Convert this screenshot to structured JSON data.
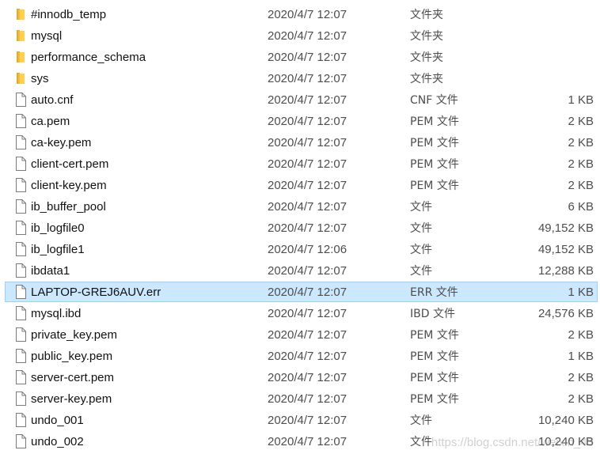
{
  "colors": {
    "folder_fill": "#ffd04a",
    "selected_bg": "#cce8ff",
    "selected_border": "#99d1ff"
  },
  "files": [
    {
      "name": "#innodb_temp",
      "date": "2020/4/7 12:07",
      "type": "文件夹",
      "size": "",
      "icon": "folder-icon"
    },
    {
      "name": "mysql",
      "date": "2020/4/7 12:07",
      "type": "文件夹",
      "size": "",
      "icon": "folder-icon"
    },
    {
      "name": "performance_schema",
      "date": "2020/4/7 12:07",
      "type": "文件夹",
      "size": "",
      "icon": "folder-icon"
    },
    {
      "name": "sys",
      "date": "2020/4/7 12:07",
      "type": "文件夹",
      "size": "",
      "icon": "folder-icon"
    },
    {
      "name": "auto.cnf",
      "date": "2020/4/7 12:07",
      "type": "CNF 文件",
      "size": "1 KB",
      "icon": "file-icon"
    },
    {
      "name": "ca.pem",
      "date": "2020/4/7 12:07",
      "type": "PEM 文件",
      "size": "2 KB",
      "icon": "file-icon"
    },
    {
      "name": "ca-key.pem",
      "date": "2020/4/7 12:07",
      "type": "PEM 文件",
      "size": "2 KB",
      "icon": "file-icon"
    },
    {
      "name": "client-cert.pem",
      "date": "2020/4/7 12:07",
      "type": "PEM 文件",
      "size": "2 KB",
      "icon": "file-icon"
    },
    {
      "name": "client-key.pem",
      "date": "2020/4/7 12:07",
      "type": "PEM 文件",
      "size": "2 KB",
      "icon": "file-icon"
    },
    {
      "name": "ib_buffer_pool",
      "date": "2020/4/7 12:07",
      "type": "文件",
      "size": "6 KB",
      "icon": "file-icon"
    },
    {
      "name": "ib_logfile0",
      "date": "2020/4/7 12:07",
      "type": "文件",
      "size": "49,152 KB",
      "icon": "file-icon"
    },
    {
      "name": "ib_logfile1",
      "date": "2020/4/7 12:06",
      "type": "文件",
      "size": "49,152 KB",
      "icon": "file-icon"
    },
    {
      "name": "ibdata1",
      "date": "2020/4/7 12:07",
      "type": "文件",
      "size": "12,288 KB",
      "icon": "file-icon"
    },
    {
      "name": "LAPTOP-GREJ6AUV.err",
      "date": "2020/4/7 12:07",
      "type": "ERR 文件",
      "size": "1 KB",
      "icon": "file-icon",
      "selected": true
    },
    {
      "name": "mysql.ibd",
      "date": "2020/4/7 12:07",
      "type": "IBD 文件",
      "size": "24,576 KB",
      "icon": "file-icon"
    },
    {
      "name": "private_key.pem",
      "date": "2020/4/7 12:07",
      "type": "PEM 文件",
      "size": "2 KB",
      "icon": "file-icon"
    },
    {
      "name": "public_key.pem",
      "date": "2020/4/7 12:07",
      "type": "PEM 文件",
      "size": "1 KB",
      "icon": "file-icon"
    },
    {
      "name": "server-cert.pem",
      "date": "2020/4/7 12:07",
      "type": "PEM 文件",
      "size": "2 KB",
      "icon": "file-icon"
    },
    {
      "name": "server-key.pem",
      "date": "2020/4/7 12:07",
      "type": "PEM 文件",
      "size": "2 KB",
      "icon": "file-icon"
    },
    {
      "name": "undo_001",
      "date": "2020/4/7 12:07",
      "type": "文件",
      "size": "10,240 KB",
      "icon": "file-icon"
    },
    {
      "name": "undo_002",
      "date": "2020/4/7 12:07",
      "type": "文件",
      "size": "10,240 KB",
      "icon": "file-icon"
    }
  ],
  "watermark": "https://blog.csdn.net/weixin_43"
}
